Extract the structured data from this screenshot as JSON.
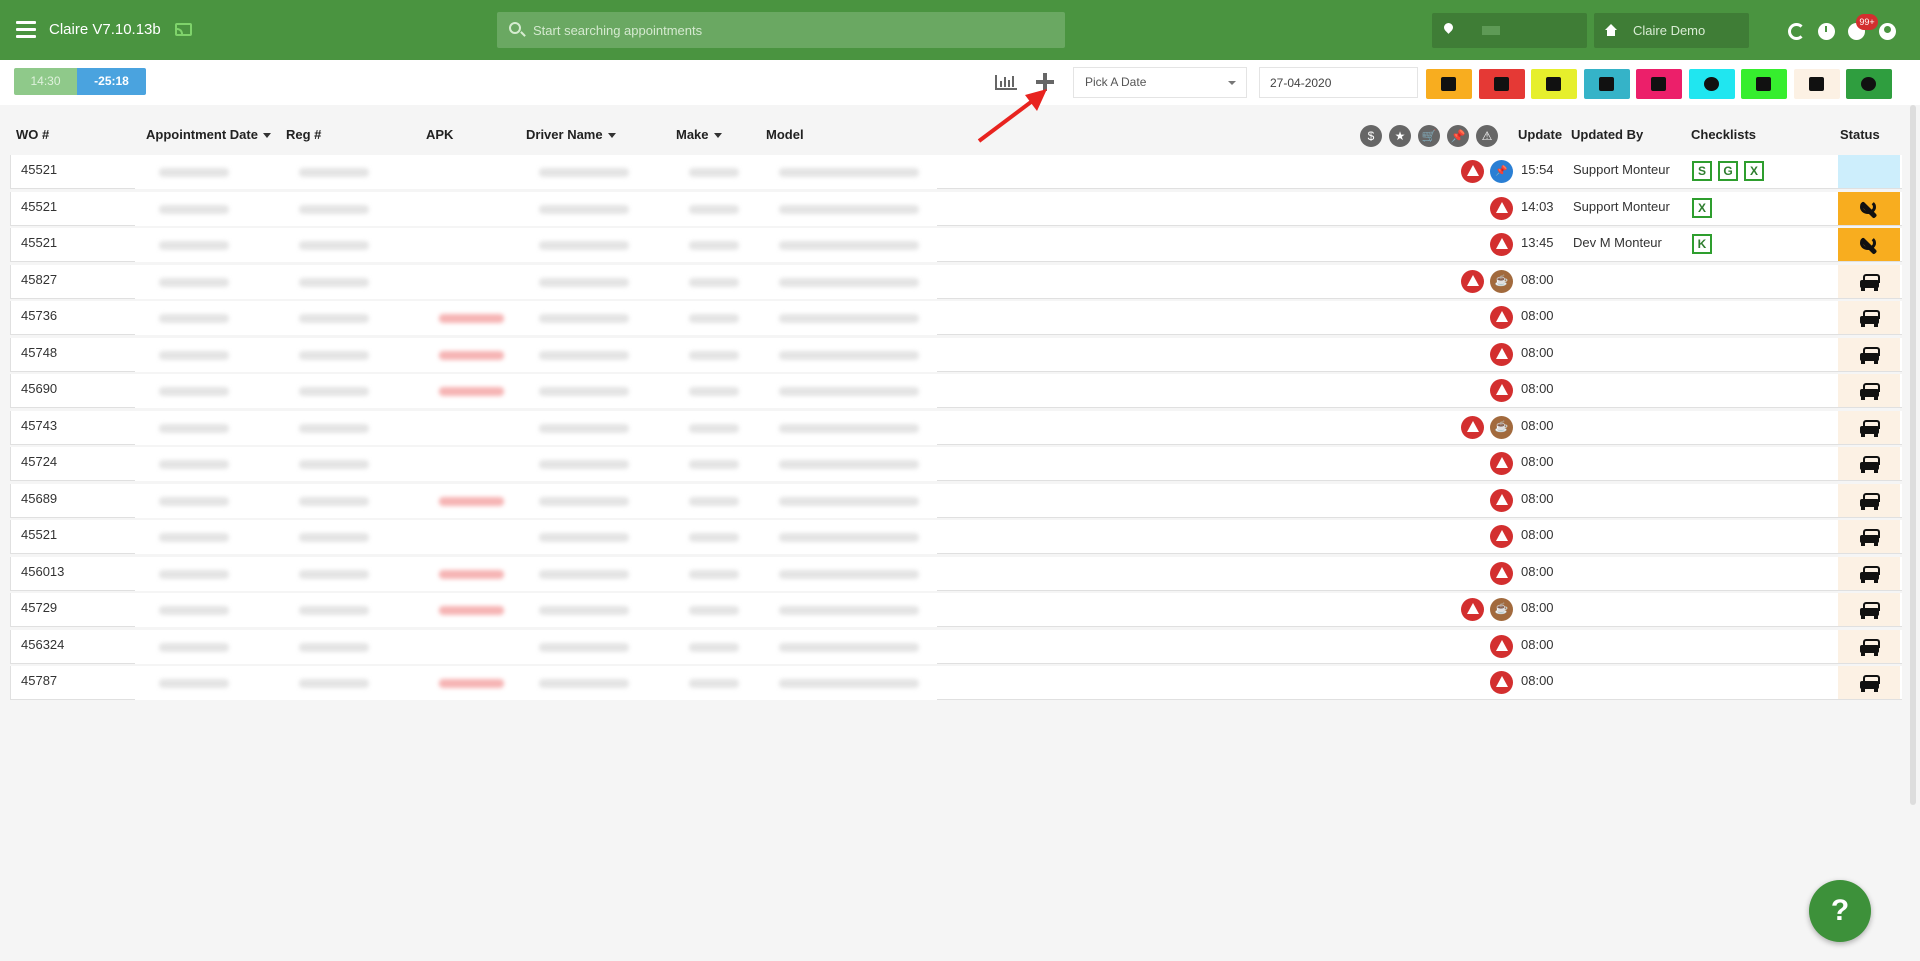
{
  "app": {
    "title": "Claire V7.10.13b",
    "search_placeholder": "Start searching appointments",
    "company": "Claire Demo",
    "notification_count": "99+"
  },
  "toolbar": {
    "time_now": "14:30",
    "time_diff": "-25:18",
    "date_picker_label": "Pick A Date",
    "date_value": "27-04-2020",
    "filters": [
      {
        "name": "wrench",
        "color": "#f8ad1f"
      },
      {
        "name": "flag-a",
        "color": "#e53935"
      },
      {
        "name": "tag",
        "color": "#e6ef2c"
      },
      {
        "name": "warning",
        "color": "#35b3c8"
      },
      {
        "name": "user-check",
        "color": "#ec1f6a"
      },
      {
        "name": "smiley",
        "color": "#20e6f0"
      },
      {
        "name": "double-check",
        "color": "#36ee2e"
      },
      {
        "name": "car",
        "color": "#fcf1e4"
      },
      {
        "name": "shield",
        "color": "#2f9e3f"
      }
    ]
  },
  "table": {
    "headers": {
      "wo": "WO #",
      "appointment_date": "Appointment Date",
      "reg": "Reg #",
      "apk": "APK",
      "driver": "Driver Name",
      "make": "Make",
      "model": "Model",
      "update": "Update",
      "updated_by": "Updated By",
      "checklists": "Checklists",
      "status": "Status"
    },
    "header_icons": [
      "dollar-icon",
      "star-icon",
      "cart-icon",
      "pin-icon",
      "warning-icon"
    ],
    "header_icon_glyphs": [
      "$",
      "★",
      "🛒",
      "📌",
      "⚠"
    ],
    "rows": [
      {
        "wo": "45521",
        "update": "15:54",
        "updated_by": "Support Monteur",
        "checklists": [
          "S",
          "G",
          "X"
        ],
        "status": "envelope",
        "icons": [
          "warning",
          "pin"
        ],
        "apk_red": false
      },
      {
        "wo": "45521",
        "update": "14:03",
        "updated_by": "Support Monteur",
        "checklists": [
          "X"
        ],
        "status": "wrench",
        "icons": [
          "warning"
        ],
        "apk_red": false
      },
      {
        "wo": "45521",
        "update": "13:45",
        "updated_by": "Dev M Monteur",
        "checklists": [
          "K"
        ],
        "status": "wrench",
        "icons": [
          "warning"
        ],
        "apk_red": false
      },
      {
        "wo": "45827",
        "update": "08:00",
        "updated_by": "",
        "checklists": [],
        "status": "car",
        "icons": [
          "warning",
          "coffee"
        ],
        "apk_red": false
      },
      {
        "wo": "45736",
        "update": "08:00",
        "updated_by": "",
        "checklists": [],
        "status": "car",
        "icons": [
          "warning"
        ],
        "apk_red": true
      },
      {
        "wo": "45748",
        "update": "08:00",
        "updated_by": "",
        "checklists": [],
        "status": "car",
        "icons": [
          "warning"
        ],
        "apk_red": true
      },
      {
        "wo": "45690",
        "update": "08:00",
        "updated_by": "",
        "checklists": [],
        "status": "car",
        "icons": [
          "warning"
        ],
        "apk_red": true
      },
      {
        "wo": "45743",
        "update": "08:00",
        "updated_by": "",
        "checklists": [],
        "status": "car",
        "icons": [
          "warning",
          "coffee"
        ],
        "apk_red": false
      },
      {
        "wo": "45724",
        "update": "08:00",
        "updated_by": "",
        "checklists": [],
        "status": "car",
        "icons": [
          "warning"
        ],
        "apk_red": false
      },
      {
        "wo": "45689",
        "update": "08:00",
        "updated_by": "",
        "checklists": [],
        "status": "car",
        "icons": [
          "warning"
        ],
        "apk_red": true
      },
      {
        "wo": "45521",
        "update": "08:00",
        "updated_by": "",
        "checklists": [],
        "status": "car",
        "icons": [
          "warning"
        ],
        "apk_red": false
      },
      {
        "wo": "456013",
        "update": "08:00",
        "updated_by": "",
        "checklists": [],
        "status": "car",
        "icons": [
          "warning"
        ],
        "apk_red": true
      },
      {
        "wo": "45729",
        "update": "08:00",
        "updated_by": "",
        "checklists": [],
        "status": "car",
        "icons": [
          "warning",
          "coffee"
        ],
        "apk_red": true
      },
      {
        "wo": "456324",
        "update": "08:00",
        "updated_by": "",
        "checklists": [],
        "status": "car",
        "icons": [
          "warning"
        ],
        "apk_red": false
      },
      {
        "wo": "45787",
        "update": "08:00",
        "updated_by": "",
        "checklists": [],
        "status": "car",
        "icons": [
          "warning"
        ],
        "apk_red": true
      }
    ]
  },
  "help": {
    "label": "?"
  }
}
